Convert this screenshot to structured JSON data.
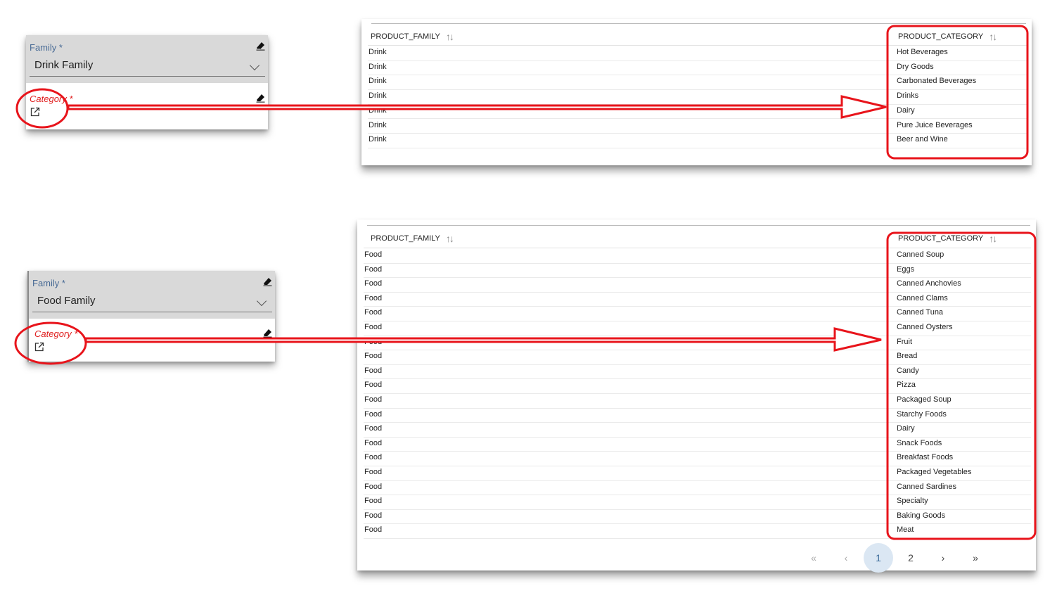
{
  "panels": [
    {
      "family_label": "Family *",
      "family_value": "Drink Family",
      "category_label": "Category *",
      "icons": {
        "clear": "eraser-icon",
        "dropdown": "chevron-down-icon",
        "open": "external-link-icon"
      }
    },
    {
      "family_label": "Family *",
      "family_value": "Food Family",
      "category_label": "Category *",
      "icons": {
        "clear": "eraser-icon",
        "dropdown": "chevron-down-icon",
        "open": "external-link-icon"
      }
    }
  ],
  "tables": [
    {
      "columns": [
        "PRODUCT_FAMILY",
        "PRODUCT_CATEGORY"
      ],
      "rows": [
        [
          "Drink",
          "Hot Beverages"
        ],
        [
          "Drink",
          "Dry Goods"
        ],
        [
          "Drink",
          "Carbonated Beverages"
        ],
        [
          "Drink",
          "Drinks"
        ],
        [
          "Drink",
          "Dairy"
        ],
        [
          "Drink",
          "Pure Juice Beverages"
        ],
        [
          "Drink",
          "Beer and Wine"
        ]
      ]
    },
    {
      "columns": [
        "PRODUCT_FAMILY",
        "PRODUCT_CATEGORY"
      ],
      "rows": [
        [
          "Food",
          "Canned Soup"
        ],
        [
          "Food",
          "Eggs"
        ],
        [
          "Food",
          "Canned Anchovies"
        ],
        [
          "Food",
          "Canned Clams"
        ],
        [
          "Food",
          "Canned Tuna"
        ],
        [
          "Food",
          "Canned Oysters"
        ],
        [
          "Food",
          "Fruit"
        ],
        [
          "Food",
          "Bread"
        ],
        [
          "Food",
          "Candy"
        ],
        [
          "Food",
          "Pizza"
        ],
        [
          "Food",
          "Packaged Soup"
        ],
        [
          "Food",
          "Starchy Foods"
        ],
        [
          "Food",
          "Dairy"
        ],
        [
          "Food",
          "Snack Foods"
        ],
        [
          "Food",
          "Breakfast Foods"
        ],
        [
          "Food",
          "Packaged Vegetables"
        ],
        [
          "Food",
          "Canned Sardines"
        ],
        [
          "Food",
          "Specialty"
        ],
        [
          "Food",
          "Baking Goods"
        ],
        [
          "Food",
          "Meat"
        ]
      ],
      "pagination": {
        "first": "«",
        "prev": "‹",
        "pages": [
          "1",
          "2"
        ],
        "current": "1",
        "next": "›",
        "last": "»"
      }
    }
  ],
  "colors": {
    "annotation": "#e8141b",
    "label": "#4a6c96",
    "required_label": "#e02020",
    "active_page_bg": "#dbe7f3"
  }
}
